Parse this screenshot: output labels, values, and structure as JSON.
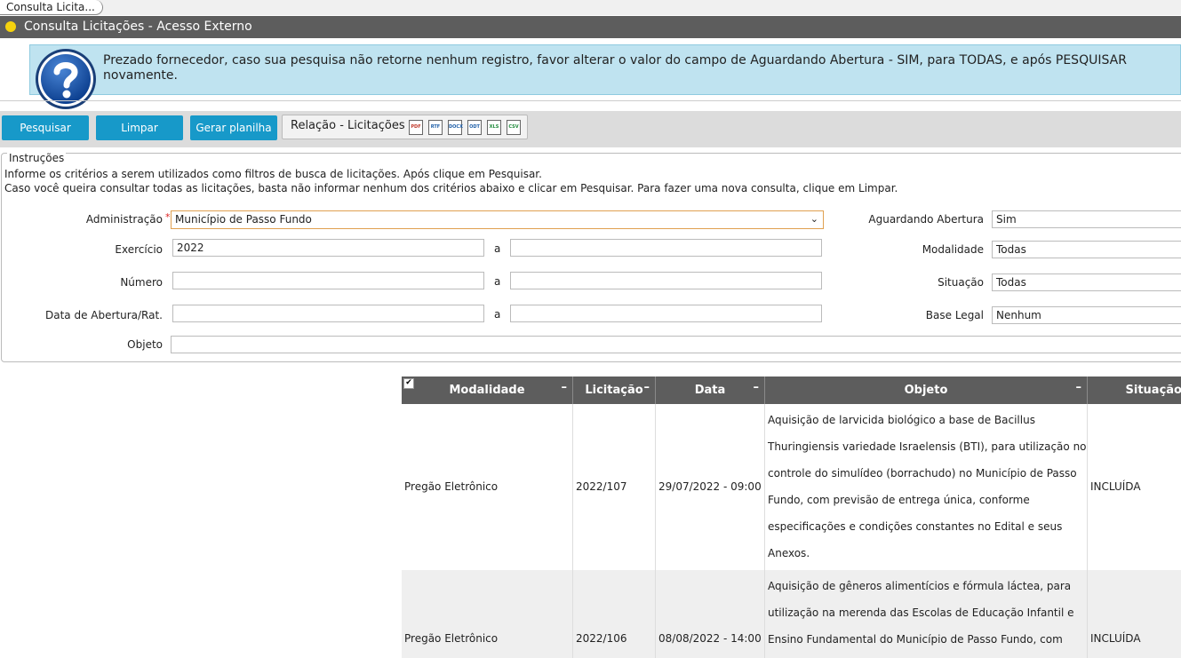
{
  "tab": {
    "label": "Consulta Licita..."
  },
  "window": {
    "title": "Consulta Licitações - Acesso Externo"
  },
  "notice": {
    "text": "Prezado fornecedor, caso sua pesquisa não retorne nenhum registro, favor alterar o valor do campo de Aguardando Abertura - SIM, para TODAS, e após PESQUISAR novamente."
  },
  "toolbar": {
    "search_label": "Pesquisar",
    "clear_label": "Limpar",
    "sheet_label": "Gerar planilha",
    "relation_label": "Relação - Licitações",
    "export_icons": [
      "PDF",
      "RTF",
      "DOCX",
      "ODT",
      "XLS",
      "CSV"
    ]
  },
  "instructions": {
    "legend": "Instruções",
    "line1": "Informe os critérios a serem utilizados como filtros de busca de licitações. Após clique em Pesquisar.",
    "line2": "Caso você queira consultar todas as licitações, basta não informar nenhum dos critérios abaixo e clicar em Pesquisar. Para fazer uma nova consulta, clique em Limpar."
  },
  "form": {
    "administracao": {
      "label": "Administração",
      "required": "*",
      "value": "Município de Passo Fundo"
    },
    "exercicio": {
      "label": "Exercício",
      "from": "2022",
      "to": ""
    },
    "numero": {
      "label": "Número",
      "from": "",
      "to": ""
    },
    "data": {
      "label": "Data de Abertura/Rat.",
      "from": "",
      "to": ""
    },
    "objeto": {
      "label": "Objeto",
      "value": ""
    },
    "range_sep": "a",
    "aguardando": {
      "label": "Aguardando Abertura",
      "value": "Sim"
    },
    "modalidade": {
      "label": "Modalidade",
      "value": "Todas"
    },
    "situacao": {
      "label": "Situação",
      "value": "Todas"
    },
    "base_legal": {
      "label": "Base Legal",
      "value": "Nenhum"
    }
  },
  "grid": {
    "select_all_mark": "✔",
    "columns": [
      "Modalidade",
      "Licitação",
      "Data",
      "Objeto",
      "Situação"
    ],
    "rows": [
      {
        "modalidade": "Pregão Eletrônico",
        "licitacao": "2022/107",
        "data": "29/07/2022 - 09:00",
        "objeto": "Aquisição de larvicida biológico a base de Bacillus Thuringiensis variedade Israelensis (BTI), para utilização no controle do simulídeo (borrachudo) no Município de Passo Fundo, com previsão de entrega única, conforme especificações e condições constantes no Edital e seus Anexos.",
        "situacao": "INCLUÍDA"
      },
      {
        "modalidade": "Pregão Eletrônico",
        "licitacao": "2022/106",
        "data": "08/08/2022 - 14:00",
        "objeto": "Aquisição de gêneros alimentícios e fórmula láctea, para utilização na merenda das Escolas de Educação Infantil e Ensino Fundamental do Município de Passo Fundo, com",
        "situacao": "INCLUÍDA"
      }
    ]
  }
}
